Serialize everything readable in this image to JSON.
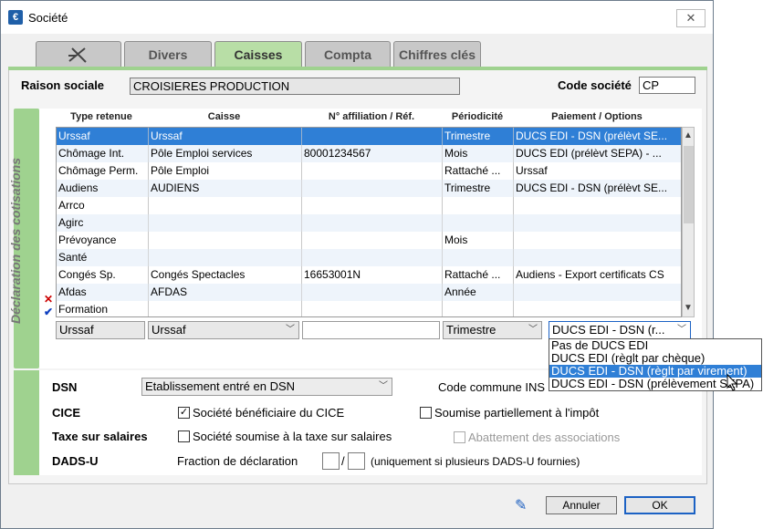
{
  "window": {
    "title": "Société",
    "close_label": "✕"
  },
  "tabs": [
    {
      "label": "",
      "icon": "tools-icon"
    },
    {
      "label": "Divers"
    },
    {
      "label": "Caisses",
      "active": true
    },
    {
      "label": "Compta"
    },
    {
      "label": "Chiffres clés"
    }
  ],
  "header": {
    "raison_label": "Raison sociale",
    "raison_value": "CROISIERES PRODUCTION",
    "code_label": "Code société",
    "code_value": "CP"
  },
  "section_label": "Déclaration des cotisations",
  "table": {
    "columns": [
      "Type retenue",
      "Caisse",
      "N° affiliation / Réf.",
      "Périodicité",
      "Paiement / Options"
    ],
    "rows": [
      [
        "Urssaf",
        "Urssaf",
        "",
        "Trimestre",
        "DUCS EDI - DSN (prélèvt SE..."
      ],
      [
        "Chômage Int.",
        "Pôle Emploi services",
        "80001234567",
        "Mois",
        "DUCS EDI (prélèvt SEPA) - ..."
      ],
      [
        "Chômage Perm.",
        "Pôle Emploi",
        "",
        "Rattaché ...",
        "Urssaf"
      ],
      [
        "Audiens",
        "AUDIENS",
        "",
        "Trimestre",
        "DUCS EDI - DSN (prélèvt SE..."
      ],
      [
        "Arrco",
        "",
        "",
        "",
        ""
      ],
      [
        "Agirc",
        "",
        "",
        "",
        ""
      ],
      [
        "Prévoyance",
        "",
        "",
        "Mois",
        ""
      ],
      [
        "Santé",
        "",
        "",
        "",
        ""
      ],
      [
        "Congés Sp.",
        "Congés Spectacles",
        "16653001N",
        "Rattaché ...",
        "Audiens - Export certificats CS"
      ],
      [
        "Afdas",
        "AFDAS",
        "",
        "Année",
        ""
      ],
      [
        "Formation",
        "",
        "",
        "",
        ""
      ]
    ]
  },
  "edit_row": {
    "type": "Urssaf",
    "caisse": "Urssaf",
    "affiliation": "",
    "periodicite": "Trimestre",
    "paiement": "DUCS EDI - DSN (r..."
  },
  "dropdown": {
    "options": [
      "Pas de DUCS EDI",
      "DUCS EDI (règlt par chèque)",
      "DUCS EDI - DSN (règlt par virement)",
      "DUCS EDI - DSN (prélèvement SEPA)"
    ],
    "selected_index": 2
  },
  "settings": {
    "dsn_label": "DSN",
    "dsn_value": "Etablissement entré en DSN",
    "code_commune_label": "Code commune INS",
    "cice_label": "CICE",
    "cice_check_label": "Société bénéficiaire du CICE",
    "cice_checked": true,
    "soumise_label": "Soumise partiellement à l'impôt",
    "soumise_checked": false,
    "taxe_label": "Taxe sur salaires",
    "taxe_check_label": "Société soumise à la taxe sur salaires",
    "taxe_checked": false,
    "abattement_label": "Abattement des associations",
    "dadsu_label": "DADS-U",
    "fraction_label": "Fraction de déclaration",
    "fraction_sep": "/",
    "fraction_note": "(uniquement si plusieurs DADS-U fournies)"
  },
  "buttons": {
    "cancel": "Annuler",
    "ok": "OK"
  },
  "colors": {
    "accent_green": "#9fd28f",
    "selection_blue": "#2f7fd6"
  }
}
